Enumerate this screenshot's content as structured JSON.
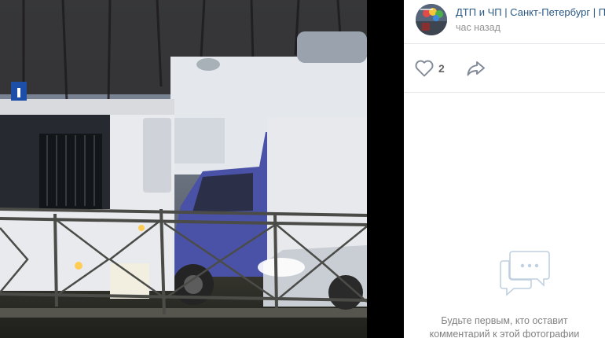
{
  "viewer": {
    "photo_alt": "Фото ДТП: автобус, грузовой фургон и легковой автомобиль"
  },
  "post": {
    "group_name": "ДТП и ЧП | Санкт-Петербург | П",
    "time": "час назад",
    "avatar_icon": "group-avatar"
  },
  "actions": {
    "likes_count": "2",
    "like_icon": "heart-icon",
    "share_icon": "share-arrow-icon"
  },
  "comments": {
    "empty_line1": "Будьте первым, кто оставит",
    "empty_line2": "комментарий к этой фотографии",
    "empty_icon": "speech-bubbles-icon"
  },
  "colors": {
    "link": "#2a5885",
    "muted": "#939393",
    "icon": "#828a99",
    "divider": "#e7e8ec"
  }
}
